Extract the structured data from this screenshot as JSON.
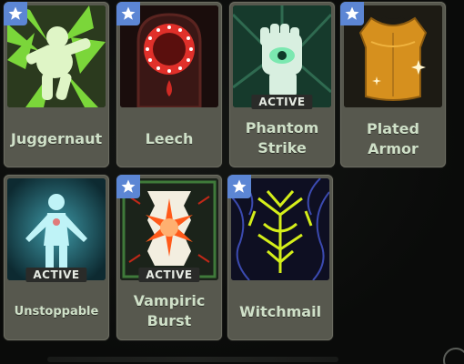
{
  "abilities": [
    {
      "name": "Juggernaut",
      "active": false,
      "starred": true,
      "icon": "juggernaut-icon"
    },
    {
      "name": "Leech",
      "active": false,
      "starred": true,
      "icon": "leech-icon"
    },
    {
      "name": "Phantom\nStrike",
      "active": true,
      "starred": false,
      "icon": "phantom-strike-icon"
    },
    {
      "name": "Plated\nArmor",
      "active": false,
      "starred": true,
      "icon": "plated-armor-icon"
    },
    {
      "name": "Unstoppable",
      "active": true,
      "starred": false,
      "icon": "unstoppable-icon"
    },
    {
      "name": "Vampiric\nBurst",
      "active": true,
      "starred": true,
      "icon": "vampiric-burst-icon"
    },
    {
      "name": "Witchmail",
      "active": false,
      "starred": true,
      "icon": "witchmail-icon"
    }
  ],
  "active_label": "ACTIVE",
  "colors": {
    "card_bg": "#57584e",
    "name_text": "#cfe0c8",
    "star_bg": "#5c86d4",
    "badge_bg": "#2a2b29"
  }
}
